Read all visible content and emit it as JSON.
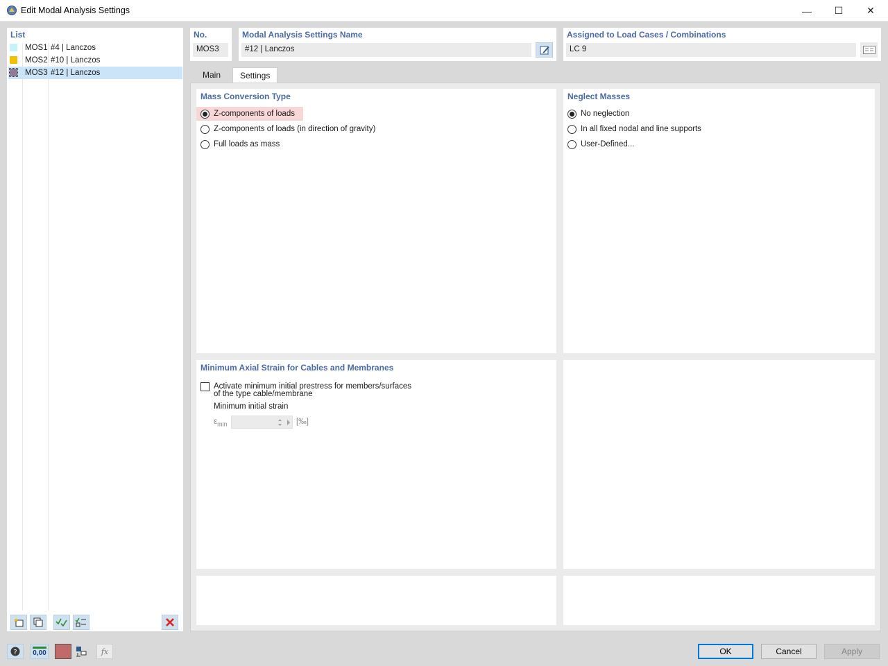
{
  "window": {
    "title": "Edit Modal Analysis Settings",
    "minimize_glyph": "—",
    "maximize_glyph": "☐",
    "close_glyph": "✕"
  },
  "list": {
    "label": "List",
    "items": [
      {
        "code": "MOS1",
        "name": "#4 | Lanczos",
        "color": "#c6f3f8",
        "selected": false
      },
      {
        "code": "MOS2",
        "name": "#10 | Lanczos",
        "color": "#f2c000",
        "selected": false
      },
      {
        "code": "MOS3",
        "name": "#12 | Lanczos",
        "color": "#8e7b96",
        "selected": true
      }
    ],
    "toolbar": [
      "new-item-icon",
      "copy-item-icon",
      "check-all-icon",
      "check-selected-icon",
      "delete-icon"
    ]
  },
  "header": {
    "no_label": "No.",
    "no_value": "MOS3",
    "name_label": "Modal Analysis Settings Name",
    "name_value": "#12 | Lanczos",
    "assigned_label": "Assigned to Load Cases / Combinations",
    "assigned_value": "LC 9"
  },
  "tabs": [
    {
      "label": "Main",
      "active": false
    },
    {
      "label": "Settings",
      "active": true
    }
  ],
  "mass_conversion": {
    "label": "Mass Conversion Type",
    "options": [
      {
        "label": "Z-components of loads",
        "selected": true
      },
      {
        "label": "Z-components of loads (in direction of gravity)",
        "selected": false
      },
      {
        "label": "Full loads as mass",
        "selected": false
      }
    ]
  },
  "neglect_masses": {
    "label": "Neglect Masses",
    "options": [
      {
        "label": "No neglection",
        "selected": true
      },
      {
        "label": "In all fixed nodal and line supports",
        "selected": false
      },
      {
        "label": "User-Defined...",
        "selected": false
      }
    ]
  },
  "axial_strain": {
    "label": "Minimum Axial Strain for Cables and Membranes",
    "checkbox_line1": "Activate minimum initial prestress for members/surfaces",
    "checkbox_line2": "of the type cable/membrane",
    "checked": false,
    "min_strain_label": "Minimum initial strain",
    "symbol_main": "ε",
    "symbol_sub": "min",
    "value": "",
    "unit": "[‰]"
  },
  "footer": {
    "ok": "OK",
    "cancel": "Cancel",
    "apply": "Apply",
    "units_icon_text": "0,00",
    "fx_text": "fx"
  },
  "colors": {
    "accent_label": "#4a6aa5",
    "selection": "#cce4f7",
    "highlight": "#f7d7d7",
    "delete": "#e02020"
  }
}
